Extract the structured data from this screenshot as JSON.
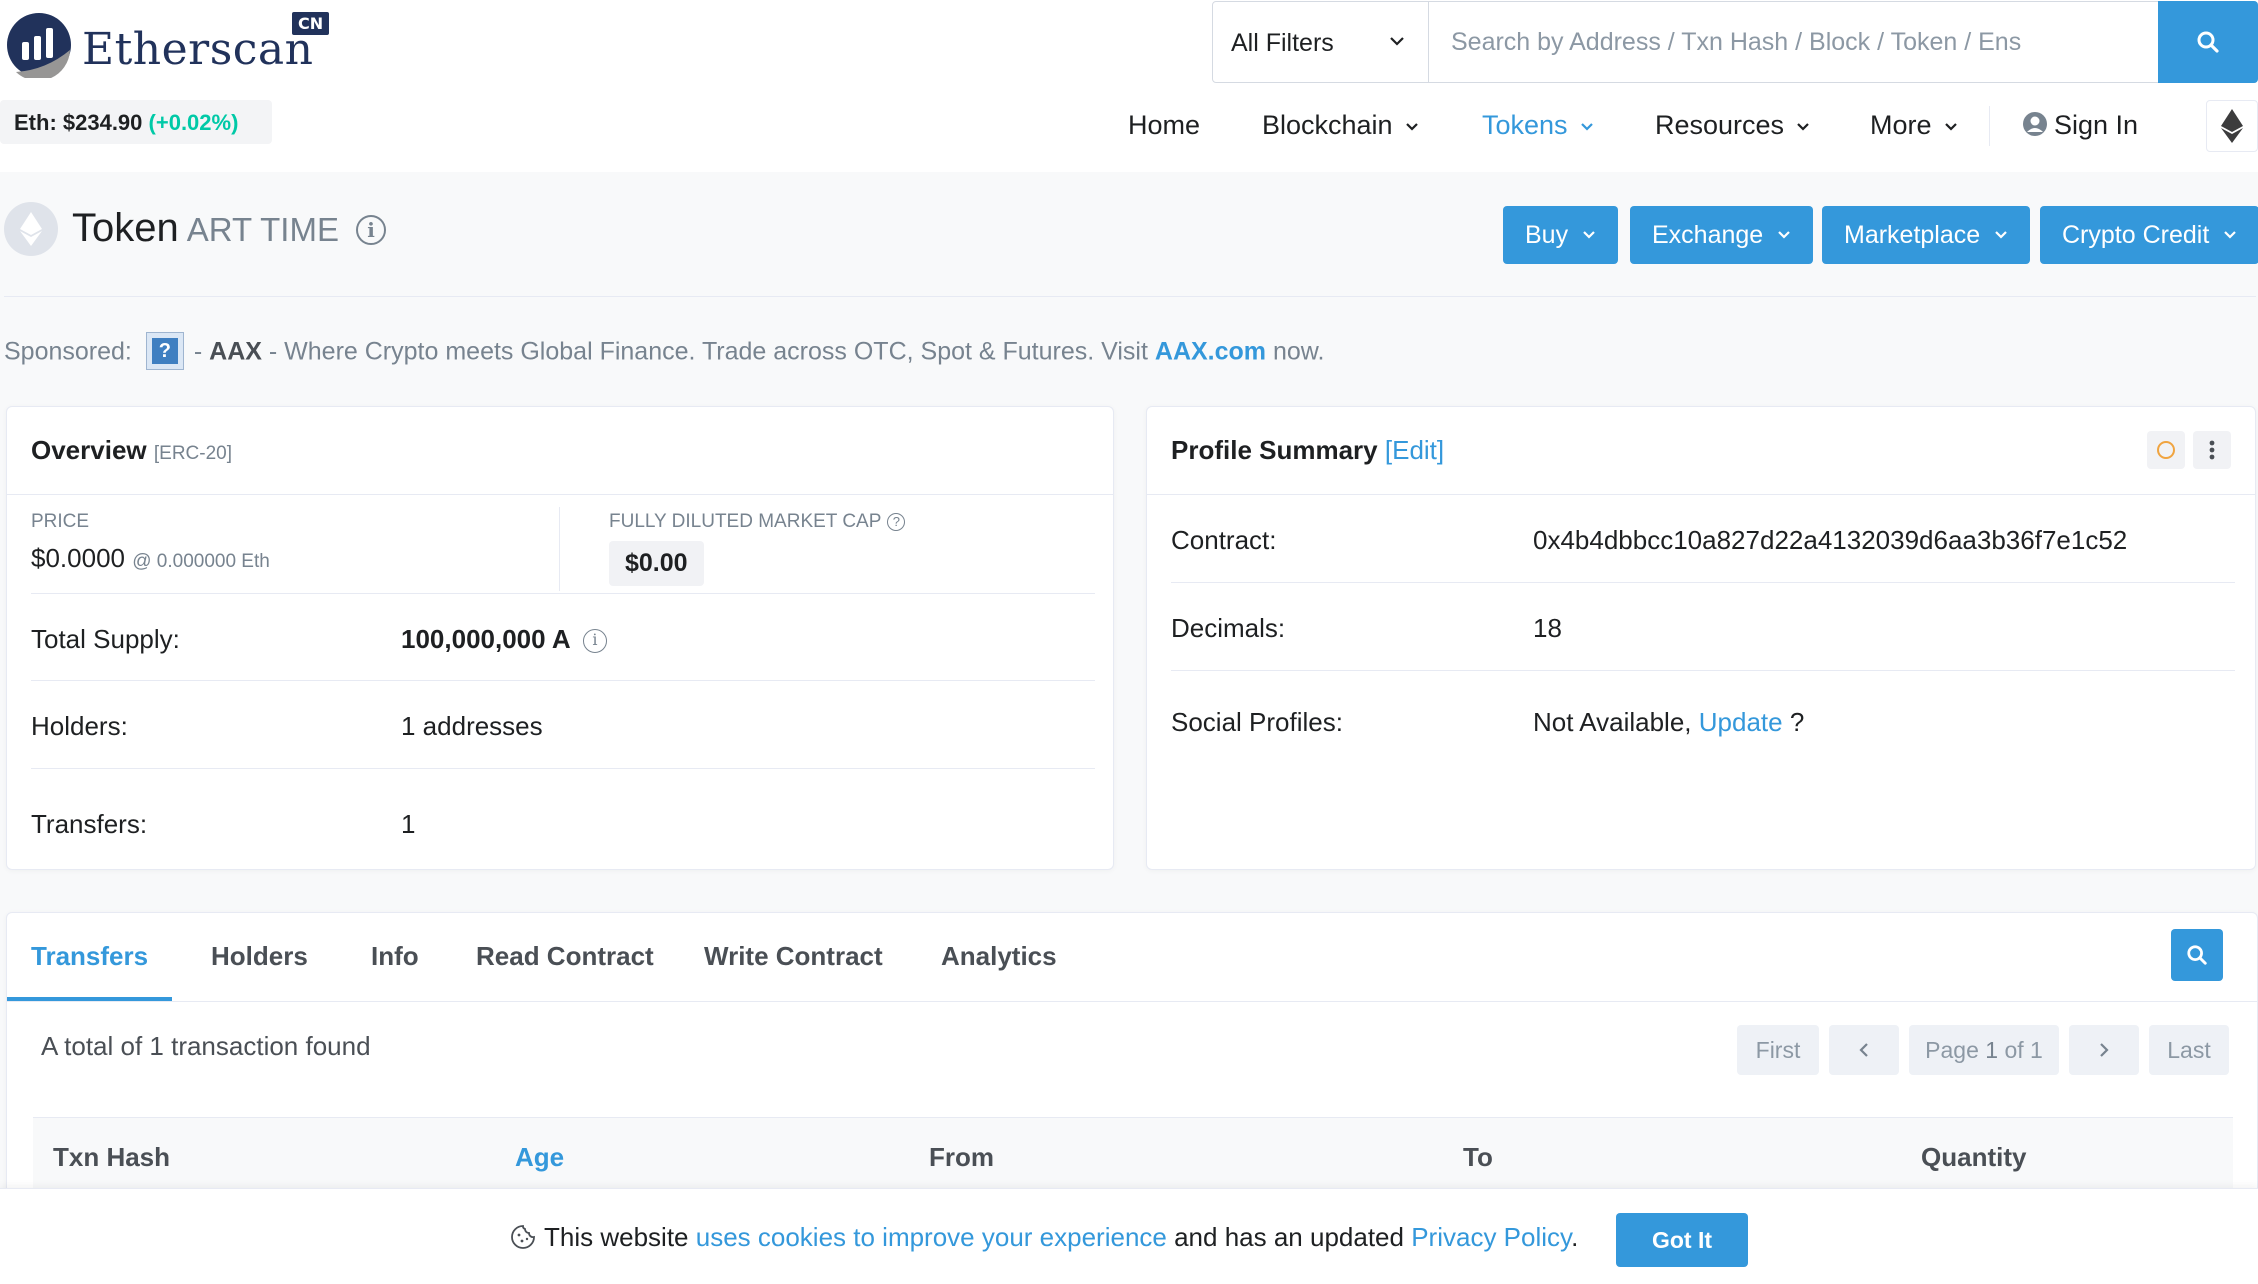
{
  "header": {
    "logo_text": "Etherscan",
    "logo_badge": "CN",
    "eth_price_label": "Eth: $234.90",
    "eth_price_change": "(+0.02%)",
    "filter_label": "All Filters",
    "search_placeholder": "Search by Address / Txn Hash / Block / Token / Ens",
    "nav": {
      "home": "Home",
      "blockchain": "Blockchain",
      "tokens": "Tokens",
      "resources": "Resources",
      "more": "More",
      "sign_in": "Sign In"
    },
    "colors": {
      "accent": "#3498db",
      "brand": "#21325b",
      "positive": "#00c9a7"
    }
  },
  "token": {
    "label": "Token",
    "name": "ART TIME",
    "actions": {
      "buy": "Buy",
      "exchange": "Exchange",
      "marketplace": "Marketplace",
      "crypto_credit": "Crypto Credit"
    }
  },
  "sponsored": {
    "label": "Sponsored:",
    "dash1": "-",
    "brand": "AAX",
    "text": "- Where Crypto meets Global Finance. Trade across OTC, Spot & Futures. Visit",
    "link": "AAX.com",
    "tail": "now."
  },
  "overview": {
    "title": "Overview",
    "standard": "[ERC-20]",
    "price_label": "PRICE",
    "price_value": "$0.0000",
    "price_eth": "@ 0.000000 Eth",
    "mcap_label": "FULLY DILUTED MARKET CAP",
    "mcap_value": "$0.00",
    "total_supply_label": "Total Supply:",
    "total_supply_value": "100,000,000 A",
    "holders_label": "Holders:",
    "holders_value": "1 addresses",
    "transfers_label": "Transfers:",
    "transfers_value": "1"
  },
  "profile": {
    "title": "Profile Summary",
    "edit": "[Edit]",
    "contract_label": "Contract:",
    "contract_value": "0x4b4dbbcc10a827d22a4132039d6aa3b36f7e1c52",
    "decimals_label": "Decimals:",
    "decimals_value": "18",
    "social_label": "Social Profiles:",
    "social_value": "Not Available,",
    "social_link": "Update",
    "social_tail": "?"
  },
  "tabs": {
    "items": [
      "Transfers",
      "Holders",
      "Info",
      "Read Contract",
      "Write Contract",
      "Analytics"
    ],
    "total_text": "A total of 1 transaction found",
    "pager": {
      "first": "First",
      "page_prefix": "Page",
      "page_num": "1",
      "page_of": "of 1",
      "last": "Last"
    },
    "columns": [
      "Txn Hash",
      "Age",
      "From",
      "To",
      "Quantity"
    ]
  },
  "cookie": {
    "text1": "This website",
    "link1": "uses cookies to improve your experience",
    "text2": "and has an updated",
    "link2": "Privacy Policy",
    "text3": ".",
    "button": "Got It"
  }
}
